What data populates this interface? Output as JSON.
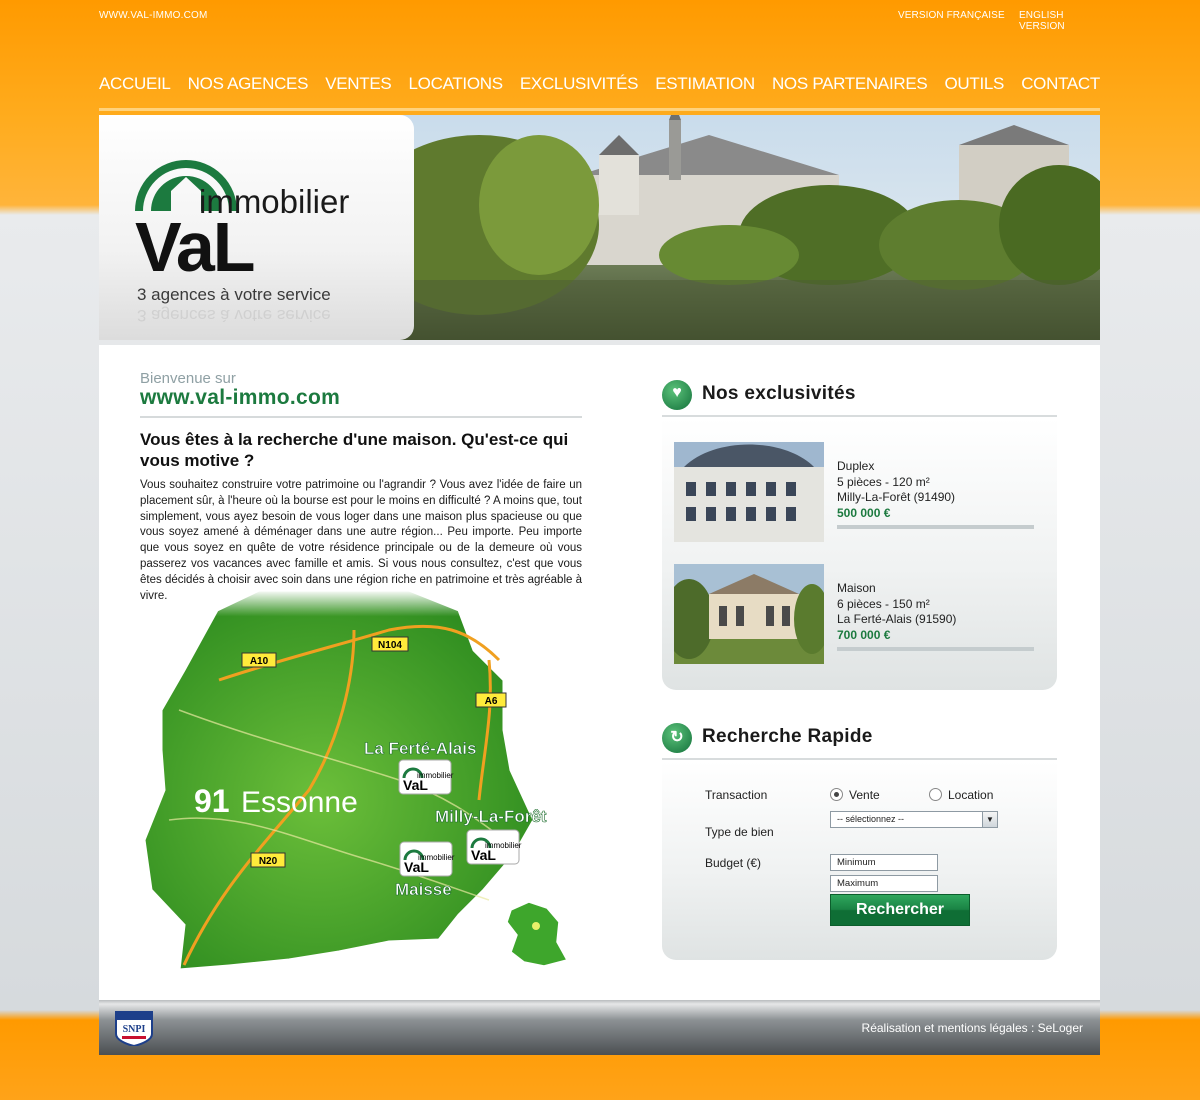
{
  "topbar": {
    "site": "WWW.VAL-IMMO.COM",
    "lang_fr": "VERSION FRANÇAISE",
    "lang_en": "ENGLISH VERSION"
  },
  "nav": [
    "ACCUEIL",
    "NOS AGENCES",
    "VENTES",
    "LOCATIONS",
    "EXCLUSIVITÉS",
    "ESTIMATION",
    "NOS PARTENAIRES",
    "OUTILS",
    "CONTACT"
  ],
  "logo": {
    "word1": "immobilier",
    "word2": "VaL",
    "slogan": "3 agences à votre service"
  },
  "welcome": {
    "small": "Bienvenue sur",
    "url": "www.val-immo.com",
    "headline": "Vous êtes à la recherche d'une maison. Qu'est-ce qui vous motive ?",
    "body": "Vous souhaitez construire votre patrimoine ou l'agrandir ? Vous avez l'idée de faire un placement sûr, à l'heure où la bourse est pour le moins en difficulté ? A moins que, tout simplement, vous ayez besoin de vous loger dans une maison plus spacieuse ou que vous soyez amené à déménager dans une autre région... Peu importe. Peu importe que vous soyez en quête de votre résidence principale ou de la demeure où vous passerez vos vacances avec famille et amis. Si vous nous consultez, c'est que vous êtes décidés à choisir avec soin dans une région riche en patrimoine et très agréable à vivre."
  },
  "map": {
    "dept_num": "91",
    "dept_name": "Essonne",
    "roads": [
      "A10",
      "N104",
      "A6",
      "N20"
    ],
    "cities": [
      "La Ferté-Alais",
      "Milly-La-Forêt",
      "Maisse"
    ],
    "badge_word1": "immobilier",
    "badge_word2": "VaL"
  },
  "exclusivites": {
    "title": "Nos exclusivités",
    "listings": [
      {
        "type": "Duplex",
        "desc": "5 pièces - 120 m²",
        "city": "Milly-La-Forêt (91490)",
        "price": "500 000 €"
      },
      {
        "type": "Maison",
        "desc": "6 pièces - 150 m²",
        "city": "La Ferté-Alais (91590)",
        "price": "700 000 €"
      }
    ]
  },
  "search": {
    "title": "Recherche Rapide",
    "transaction_label": "Transaction",
    "opt_vente": "Vente",
    "opt_location": "Location",
    "type_label": "Type de bien",
    "type_value": "-- sélectionnez --",
    "budget_label": "Budget (€)",
    "min_placeholder": "Minimum",
    "max_placeholder": "Maximum",
    "button": "Rechercher"
  },
  "footer": {
    "logo": "SNPI",
    "credit": "Réalisation et mentions légales : SeLoger"
  },
  "colors": {
    "orange": "#ff9a00",
    "green": "#1c7a3f",
    "grey": "#4b4f52"
  }
}
